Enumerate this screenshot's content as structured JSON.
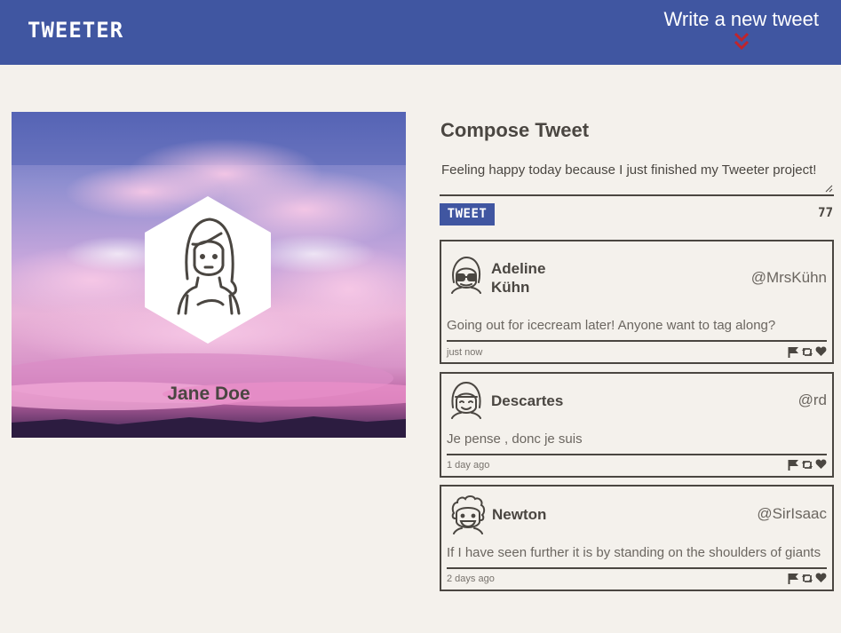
{
  "nav": {
    "brand": "TWEETER",
    "write_label": "Write a new tweet",
    "write_icon": "double-chevron-down-icon",
    "accent_color": "#c0242c",
    "bg_color": "#4056a1"
  },
  "profile": {
    "name": "Jane Doe",
    "avatar_icon": "girl-avatar-icon"
  },
  "compose": {
    "title": "Compose Tweet",
    "text": "Feeling happy today because I just finished my Tweeter project!",
    "button_label": "TWEET",
    "counter": "77"
  },
  "tweets": [
    {
      "name_line1": "Adeline",
      "name_line2": "Kühn",
      "handle": "@MrsKühn",
      "content": "Going out for icecream later! Anyone want to tag along?",
      "time": "just now",
      "avatar_icon": "glasses-avatar-icon"
    },
    {
      "name": "Descartes",
      "handle": "@rd",
      "content": "Je pense , donc je suis",
      "time": "1 day ago",
      "avatar_icon": "bob-hair-avatar-icon"
    },
    {
      "name": "Newton",
      "handle": "@SirIsaac",
      "content": "If I have seen further it is by standing on the shoulders of giants",
      "time": "2 days ago",
      "avatar_icon": "curly-hair-avatar-icon"
    }
  ],
  "actions": [
    "flag-icon",
    "retweet-icon",
    "heart-icon"
  ]
}
